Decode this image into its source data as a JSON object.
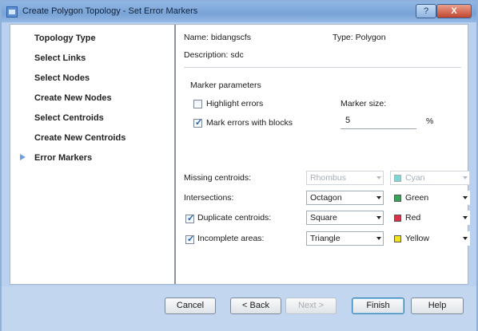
{
  "window": {
    "title": "Create Polygon Topology - Set Error Markers",
    "help_label": "?",
    "close_label": "X"
  },
  "steps": [
    {
      "label": "Topology Type"
    },
    {
      "label": "Select Links"
    },
    {
      "label": "Select Nodes"
    },
    {
      "label": "Create New Nodes"
    },
    {
      "label": "Select Centroids"
    },
    {
      "label": "Create New Centroids"
    },
    {
      "label": "Error Markers",
      "current": true
    }
  ],
  "info": {
    "name_label": "Name: bidangscfs",
    "type_label": "Type: Polygon",
    "description_label": "Description: sdc"
  },
  "marker_parameters": {
    "group_label": "Marker parameters",
    "highlight_errors": {
      "label": "Highlight errors",
      "checked": false
    },
    "mark_with_blocks": {
      "label": "Mark errors with blocks",
      "checked": true
    },
    "size_label": "Marker size:",
    "size_value": "5",
    "size_unit": "%"
  },
  "error_rows": {
    "missing": {
      "label": "Missing centroids:",
      "shape": "Rhombus",
      "color": "Cyan",
      "color_hex": "#7fd4d4",
      "enabled": false
    },
    "intersections": {
      "label": "Intersections:",
      "shape": "Octagon",
      "color": "Green",
      "color_hex": "#3aa35a",
      "enabled": true
    },
    "duplicates": {
      "label": "Duplicate centroids:",
      "shape": "Square",
      "color": "Red",
      "color_hex": "#d8324a",
      "checked": true,
      "enabled": true
    },
    "incomplete": {
      "label": "Incomplete areas:",
      "shape": "Triangle",
      "color": "Yellow",
      "color_hex": "#f2e022",
      "checked": true,
      "enabled": true
    }
  },
  "buttons": {
    "cancel": "Cancel",
    "back": "< Back",
    "next": "Next >",
    "finish": "Finish",
    "help": "Help"
  }
}
